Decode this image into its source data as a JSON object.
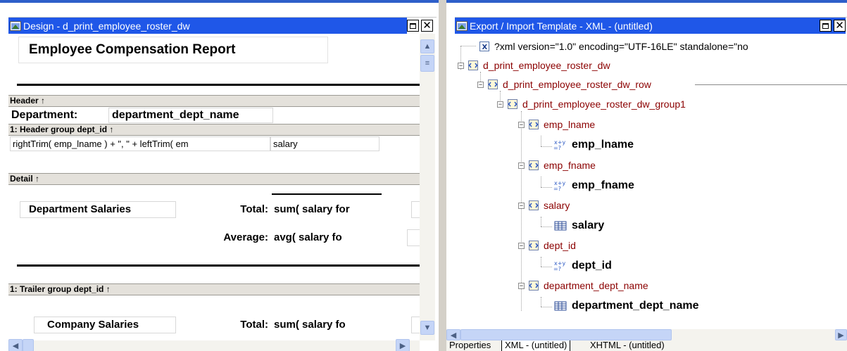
{
  "left_window": {
    "title": "Design - d_print_employee_roster_dw",
    "report_title": "Employee Compensation Report",
    "bands": {
      "header": "Header ↑",
      "group_header": "1: Header group dept_id ↑",
      "detail": "Detail ↑",
      "group_trailer": "1: Trailer group dept_id ↑"
    },
    "fields": {
      "department_label": "Department:",
      "department_value": "department_dept_name",
      "name_expression": "rightTrim( emp_lname ) + \",  \" + leftTrim( em",
      "salary": "salary",
      "dept_salaries_label": "Department Salaries",
      "total_label": "Total:",
      "total_expr": "sum( salary  for",
      "average_label": "Average:",
      "average_expr": "avg(  salary  fo",
      "company_salaries_label": "Company Salaries",
      "company_total_label": "Total:",
      "company_total_expr": "sum(  salary  fo"
    }
  },
  "right_window": {
    "title": "Export / Import Template - XML - (untitled)",
    "tree": [
      {
        "label": "?xml version=\"1.0\" encoding=\"UTF-16LE\" standalone=\"no"
      },
      {
        "label": "d_print_employee_roster_dw"
      },
      {
        "label": "d_print_employee_roster_dw_row"
      },
      {
        "label": "d_print_employee_roster_dw_group1"
      },
      {
        "label": "emp_lname"
      },
      {
        "label": "emp_lname"
      },
      {
        "label": "emp_fname"
      },
      {
        "label": "emp_fname"
      },
      {
        "label": "salary"
      },
      {
        "label": "salary"
      },
      {
        "label": "dept_id"
      },
      {
        "label": "dept_id"
      },
      {
        "label": "department_dept_name"
      },
      {
        "label": "department_dept_name"
      }
    ],
    "tabs": [
      "Properties",
      "XML - (untitled)",
      "XHTML - (untitled)"
    ]
  },
  "icons": {
    "minimize": "maximize-icon",
    "close": "close-icon",
    "window": "window-icon"
  },
  "colors": {
    "titlebar": "#1f57e8",
    "element_label": "#8b0000",
    "band": "#e4e1db"
  }
}
